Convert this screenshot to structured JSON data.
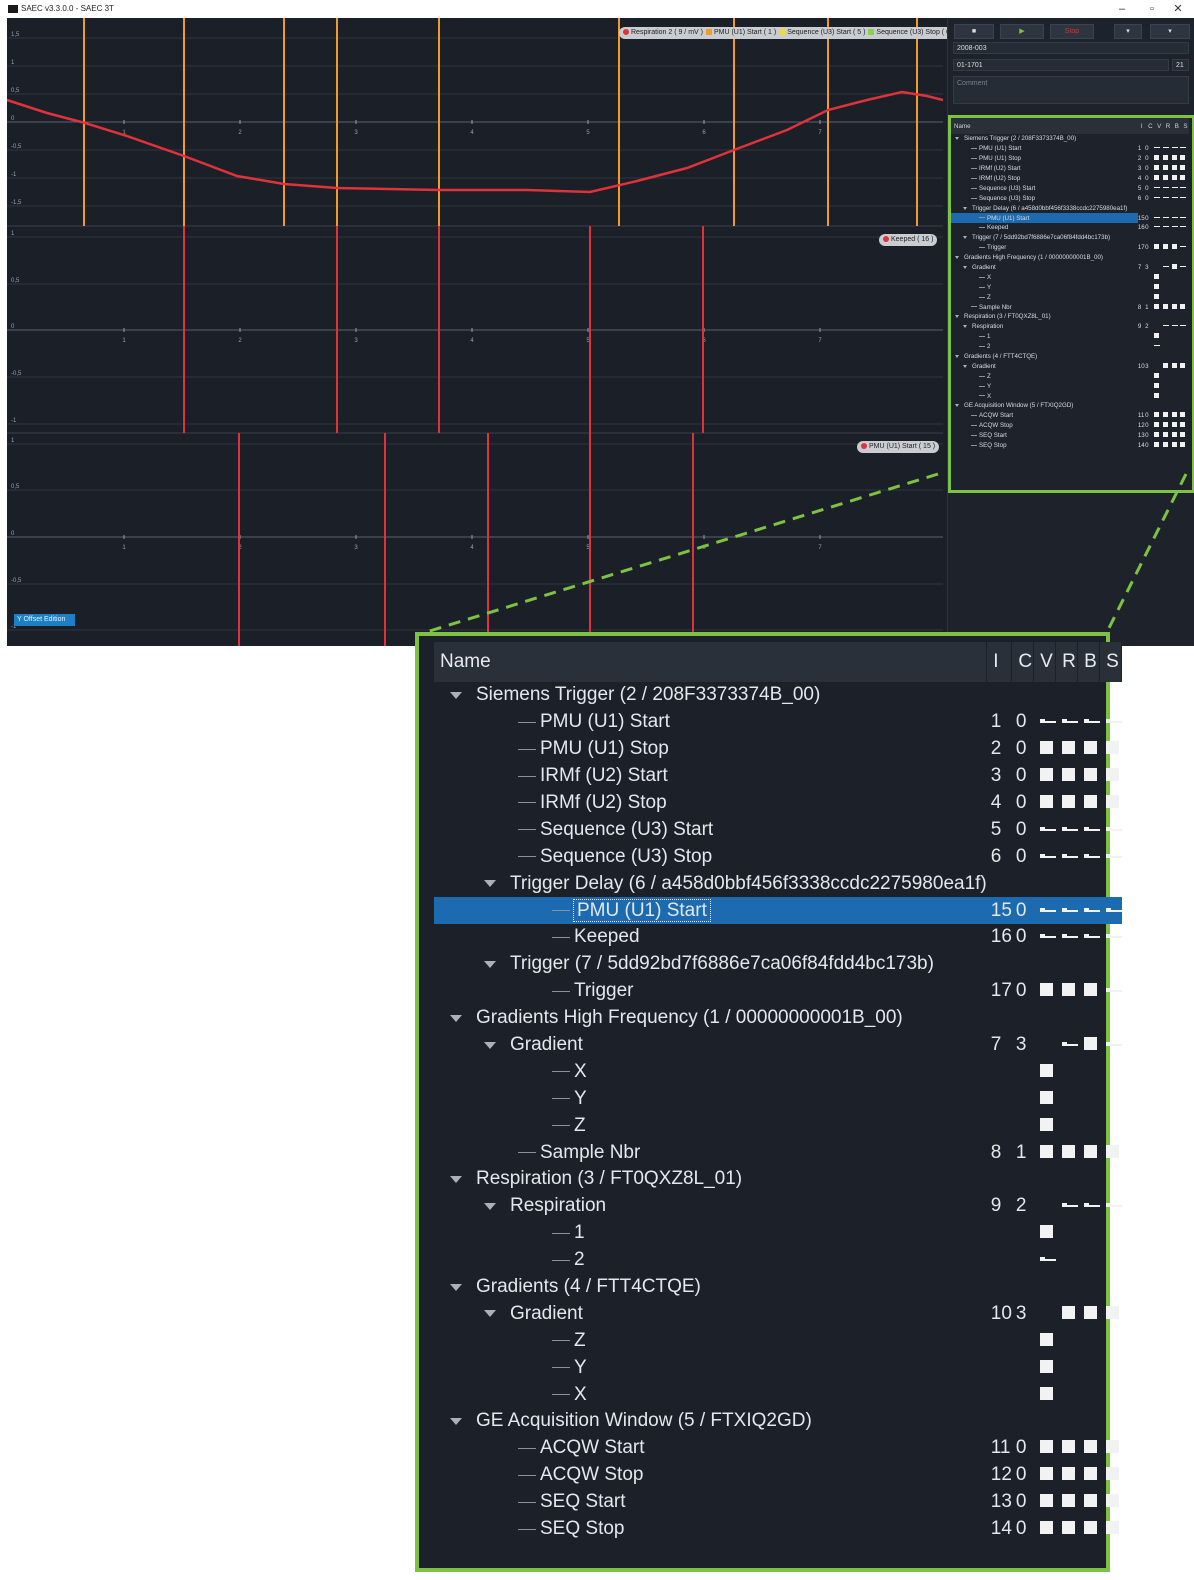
{
  "window": {
    "title": "SAEC v3.3.0.0 - SAEC 3T",
    "minimize": "–",
    "maximize": "▫",
    "close": "✕"
  },
  "controls": {
    "field1": "2008-003",
    "field2": "01-1701",
    "field2_suffix": "21",
    "comment_placeholder": "Comment",
    "btn1": "■",
    "btn2": "▶",
    "btn3": "Stop"
  },
  "plot": {
    "y_offset_label": "Y Offset Edition",
    "legend_top": [
      "Respiration 2 ( 9 / mV )",
      "PMU (U1) Start ( 1 )",
      "Sequence (U3) Start ( 5 )",
      "Sequence (U3) Stop ( 6 )"
    ],
    "legend_top_colors": [
      "#e0323a",
      "#f39a2c",
      "#f2d83a",
      "#8ad14b"
    ],
    "legend_mid": "Keeped ( 16 )",
    "legend_bottom": "PMU (U1) Start ( 15 )",
    "panel1_yticks": [
      "1,5",
      "1",
      "0,5",
      "0",
      "-0,5",
      "-1",
      "-1,5"
    ],
    "panel2_yticks": [
      "1",
      "0,5",
      "0",
      "-0,5",
      "-1"
    ],
    "panel3_yticks": [
      "1",
      "0,5",
      "0",
      "-0,5",
      "-1"
    ],
    "xticks": [
      "1",
      "2",
      "3",
      "4",
      "5",
      "6",
      "7"
    ]
  },
  "tree": {
    "columns": [
      "Name",
      "I",
      "C",
      "V",
      "R",
      "B",
      "S"
    ],
    "rows": [
      {
        "depth": 0,
        "expander": true,
        "name": "Siemens Trigger (2 / 208F3373374B_00)",
        "i": "",
        "c": "",
        "v": "",
        "r": "",
        "b": "",
        "s": ""
      },
      {
        "depth": 1,
        "name": "PMU (U1) Start",
        "i": "1",
        "c": "0",
        "v": "ptr",
        "r": "ptr",
        "b": "ptr",
        "s": "ptr"
      },
      {
        "depth": 1,
        "name": "PMU (U1) Stop",
        "i": "2",
        "c": "0",
        "v": "sq",
        "r": "sq",
        "b": "sq",
        "s": "sq"
      },
      {
        "depth": 1,
        "name": "IRMf (U2) Start",
        "i": "3",
        "c": "0",
        "v": "sq",
        "r": "sq",
        "b": "sq",
        "s": "sq"
      },
      {
        "depth": 1,
        "name": "IRMf (U2) Stop",
        "i": "4",
        "c": "0",
        "v": "sq",
        "r": "sq",
        "b": "sq",
        "s": "sq"
      },
      {
        "depth": 1,
        "name": "Sequence (U3) Start",
        "i": "5",
        "c": "0",
        "v": "ptr",
        "r": "ptr",
        "b": "ptr",
        "s": "ptr"
      },
      {
        "depth": 1,
        "name": "Sequence (U3) Stop",
        "i": "6",
        "c": "0",
        "v": "ptr",
        "r": "ptr",
        "b": "ptr",
        "s": "ptr"
      },
      {
        "depth": 1,
        "expander": true,
        "name": "Trigger Delay (6 / a458d0bbf456f3338ccdc2275980ea1f)",
        "i": "",
        "c": "",
        "v": "",
        "r": "",
        "b": "",
        "s": ""
      },
      {
        "depth": 2,
        "selected": true,
        "name": "PMU (U1) Start",
        "i": "15",
        "c": "0",
        "v": "ptr",
        "r": "ptr",
        "b": "ptr",
        "s": "ptr"
      },
      {
        "depth": 2,
        "name": "Keeped",
        "i": "16",
        "c": "0",
        "v": "ptr",
        "r": "ptr",
        "b": "ptr",
        "s": "ptr"
      },
      {
        "depth": 1,
        "expander": true,
        "name": "Trigger (7 / 5dd92bd7f6886e7ca06f84fdd4bc173b)",
        "i": "",
        "c": "",
        "v": "",
        "r": "",
        "b": "",
        "s": ""
      },
      {
        "depth": 2,
        "name": "Trigger",
        "i": "17",
        "c": "0",
        "v": "sq",
        "r": "sq",
        "b": "sq",
        "s": "ptr"
      },
      {
        "depth": 0,
        "expander": true,
        "name": "Gradients High Frequency (1 / 00000000001B_00)",
        "i": "",
        "c": "",
        "v": "",
        "r": "",
        "b": "",
        "s": ""
      },
      {
        "depth": 1,
        "expander": true,
        "name": "Gradient",
        "i": "7",
        "c": "3",
        "v": "",
        "r": "ptr",
        "b": "sq",
        "s": "ptr"
      },
      {
        "depth": 2,
        "name": "X",
        "i": "",
        "c": "",
        "v": "sq",
        "r": "",
        "b": "",
        "s": ""
      },
      {
        "depth": 2,
        "name": "Y",
        "i": "",
        "c": "",
        "v": "sq",
        "r": "",
        "b": "",
        "s": ""
      },
      {
        "depth": 2,
        "name": "Z",
        "i": "",
        "c": "",
        "v": "sq",
        "r": "",
        "b": "",
        "s": ""
      },
      {
        "depth": 1,
        "name": "Sample Nbr",
        "i": "8",
        "c": "1",
        "v": "sq",
        "r": "sq",
        "b": "sq",
        "s": "sq"
      },
      {
        "depth": 0,
        "expander": true,
        "name": "Respiration (3 / FT0QXZ8L_01)",
        "i": "",
        "c": "",
        "v": "",
        "r": "",
        "b": "",
        "s": ""
      },
      {
        "depth": 1,
        "expander": true,
        "name": "Respiration",
        "i": "9",
        "c": "2",
        "v": "",
        "r": "ptr",
        "b": "ptr",
        "s": "ptr"
      },
      {
        "depth": 2,
        "name": "1",
        "i": "",
        "c": "",
        "v": "sq",
        "r": "",
        "b": "",
        "s": ""
      },
      {
        "depth": 2,
        "name": "2",
        "i": "",
        "c": "",
        "v": "ptr",
        "r": "",
        "b": "",
        "s": ""
      },
      {
        "depth": 0,
        "expander": true,
        "name": "Gradients (4 / FTT4CTQE)",
        "i": "",
        "c": "",
        "v": "",
        "r": "",
        "b": "",
        "s": ""
      },
      {
        "depth": 1,
        "expander": true,
        "name": "Gradient",
        "i": "10",
        "c": "3",
        "v": "",
        "r": "sq",
        "b": "sq",
        "s": "sq"
      },
      {
        "depth": 2,
        "name": "Z",
        "i": "",
        "c": "",
        "v": "sq",
        "r": "",
        "b": "",
        "s": ""
      },
      {
        "depth": 2,
        "name": "Y",
        "i": "",
        "c": "",
        "v": "sq",
        "r": "",
        "b": "",
        "s": ""
      },
      {
        "depth": 2,
        "name": "X",
        "i": "",
        "c": "",
        "v": "sq",
        "r": "",
        "b": "",
        "s": ""
      },
      {
        "depth": 0,
        "expander": true,
        "name": "GE Acquisition Window (5 / FTXIQ2GD)",
        "i": "",
        "c": "",
        "v": "",
        "r": "",
        "b": "",
        "s": ""
      },
      {
        "depth": 1,
        "name": "ACQW Start",
        "i": "11",
        "c": "0",
        "v": "sq",
        "r": "sq",
        "b": "sq",
        "s": "sq"
      },
      {
        "depth": 1,
        "name": "ACQW Stop",
        "i": "12",
        "c": "0",
        "v": "sq",
        "r": "sq",
        "b": "sq",
        "s": "sq"
      },
      {
        "depth": 1,
        "name": "SEQ Start",
        "i": "13",
        "c": "0",
        "v": "sq",
        "r": "sq",
        "b": "sq",
        "s": "sq"
      },
      {
        "depth": 1,
        "name": "SEQ Stop",
        "i": "14",
        "c": "0",
        "v": "sq",
        "r": "sq",
        "b": "sq",
        "s": "sq"
      }
    ]
  },
  "colors": {
    "accent": "#7dc242",
    "selection": "#1c6bb0",
    "signal_red": "#e0323a",
    "marker_orange": "#f39a2c",
    "background": "#1b1f27"
  }
}
